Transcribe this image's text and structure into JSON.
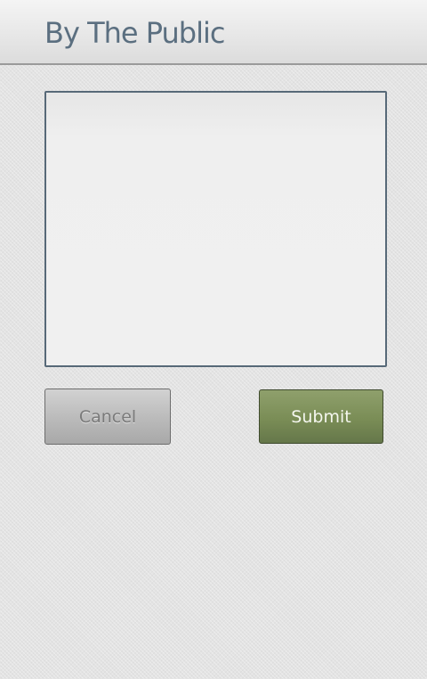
{
  "header": {
    "title": "By The Public"
  },
  "form": {
    "message_value": "",
    "cancel_label": "Cancel",
    "submit_label": "Submit"
  },
  "colors": {
    "title": "#5b6f80",
    "textarea_border": "#576978",
    "submit_bg": "#7a8d56",
    "cancel_bg": "#bcbcbc"
  }
}
